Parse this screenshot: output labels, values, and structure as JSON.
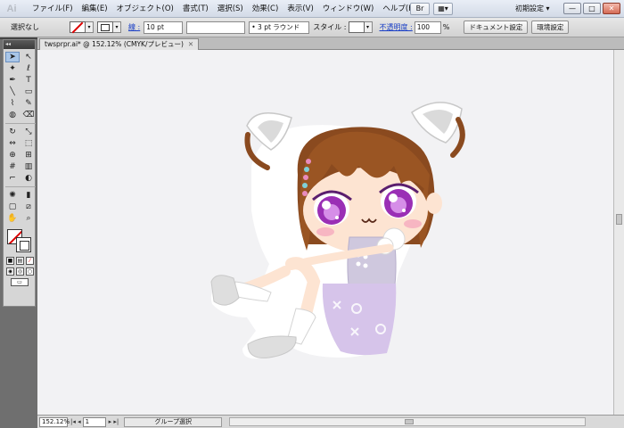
{
  "app": {
    "logo_text": "Ai",
    "workspace_label": "初期設定 ▾"
  },
  "menu": [
    "ファイル(F)",
    "編集(E)",
    "オブジェクト(O)",
    "書式(T)",
    "選択(S)",
    "効果(C)",
    "表示(V)",
    "ウィンドウ(W)",
    "ヘルプ(H)"
  ],
  "menu_buttons": [
    "Br",
    "▦▾"
  ],
  "window_buttons": [
    "—",
    "□",
    "✕"
  ],
  "control": {
    "selection_status": "選択なし",
    "stroke_link": "線 :",
    "stroke_weight": "10 pt",
    "brush_field": "",
    "brush_style": "• 3 pt ラウンド",
    "style_label": "スタイル :",
    "opacity_link": "不透明度 :",
    "opacity_value": "100",
    "opacity_unit": "%",
    "doc_setup_button": "ドキュメント設定",
    "prefs_button": "環境設定"
  },
  "doc_tab": {
    "title": "twsprpr.ai* @ 152.12% (CMYK/プレビュー)",
    "close": "✕"
  },
  "tools_header": "◂◂",
  "status": {
    "zoom": "152.12%",
    "artboard": "1",
    "mode_label": "グループ選択"
  },
  "colors": {
    "canvas_bg": "#f2f2f4",
    "hair": "#8a4a1f",
    "dress": "#d6c4ea",
    "eye": "#9a2fb5"
  }
}
